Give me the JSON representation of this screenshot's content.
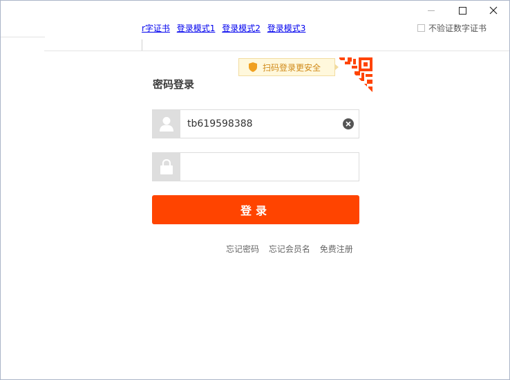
{
  "window": {
    "title": "",
    "controls": {
      "minimize_icon": "minimize-icon",
      "maximize_icon": "maximize-icon",
      "close_icon": "close-icon"
    }
  },
  "header": {
    "links": [
      "r字证书",
      "登录模式1",
      "登录模式2",
      "登录模式3"
    ],
    "no_verify_label": "不验证数字证书",
    "no_verify_checked": false
  },
  "login": {
    "title": "密码登录",
    "qr_tip": "扫码登录更安全",
    "username": {
      "value": "tb619598388",
      "placeholder": ""
    },
    "password": {
      "value": "",
      "placeholder": ""
    },
    "submit_label": "登录",
    "links": {
      "forgot_password": "忘记密码",
      "forgot_username": "忘记会员名",
      "register": "免费注册"
    }
  },
  "colors": {
    "accent": "#ff4400",
    "tip_bg": "#fff8dc",
    "tip_text": "#d08a1a",
    "link": "#0000ee"
  }
}
